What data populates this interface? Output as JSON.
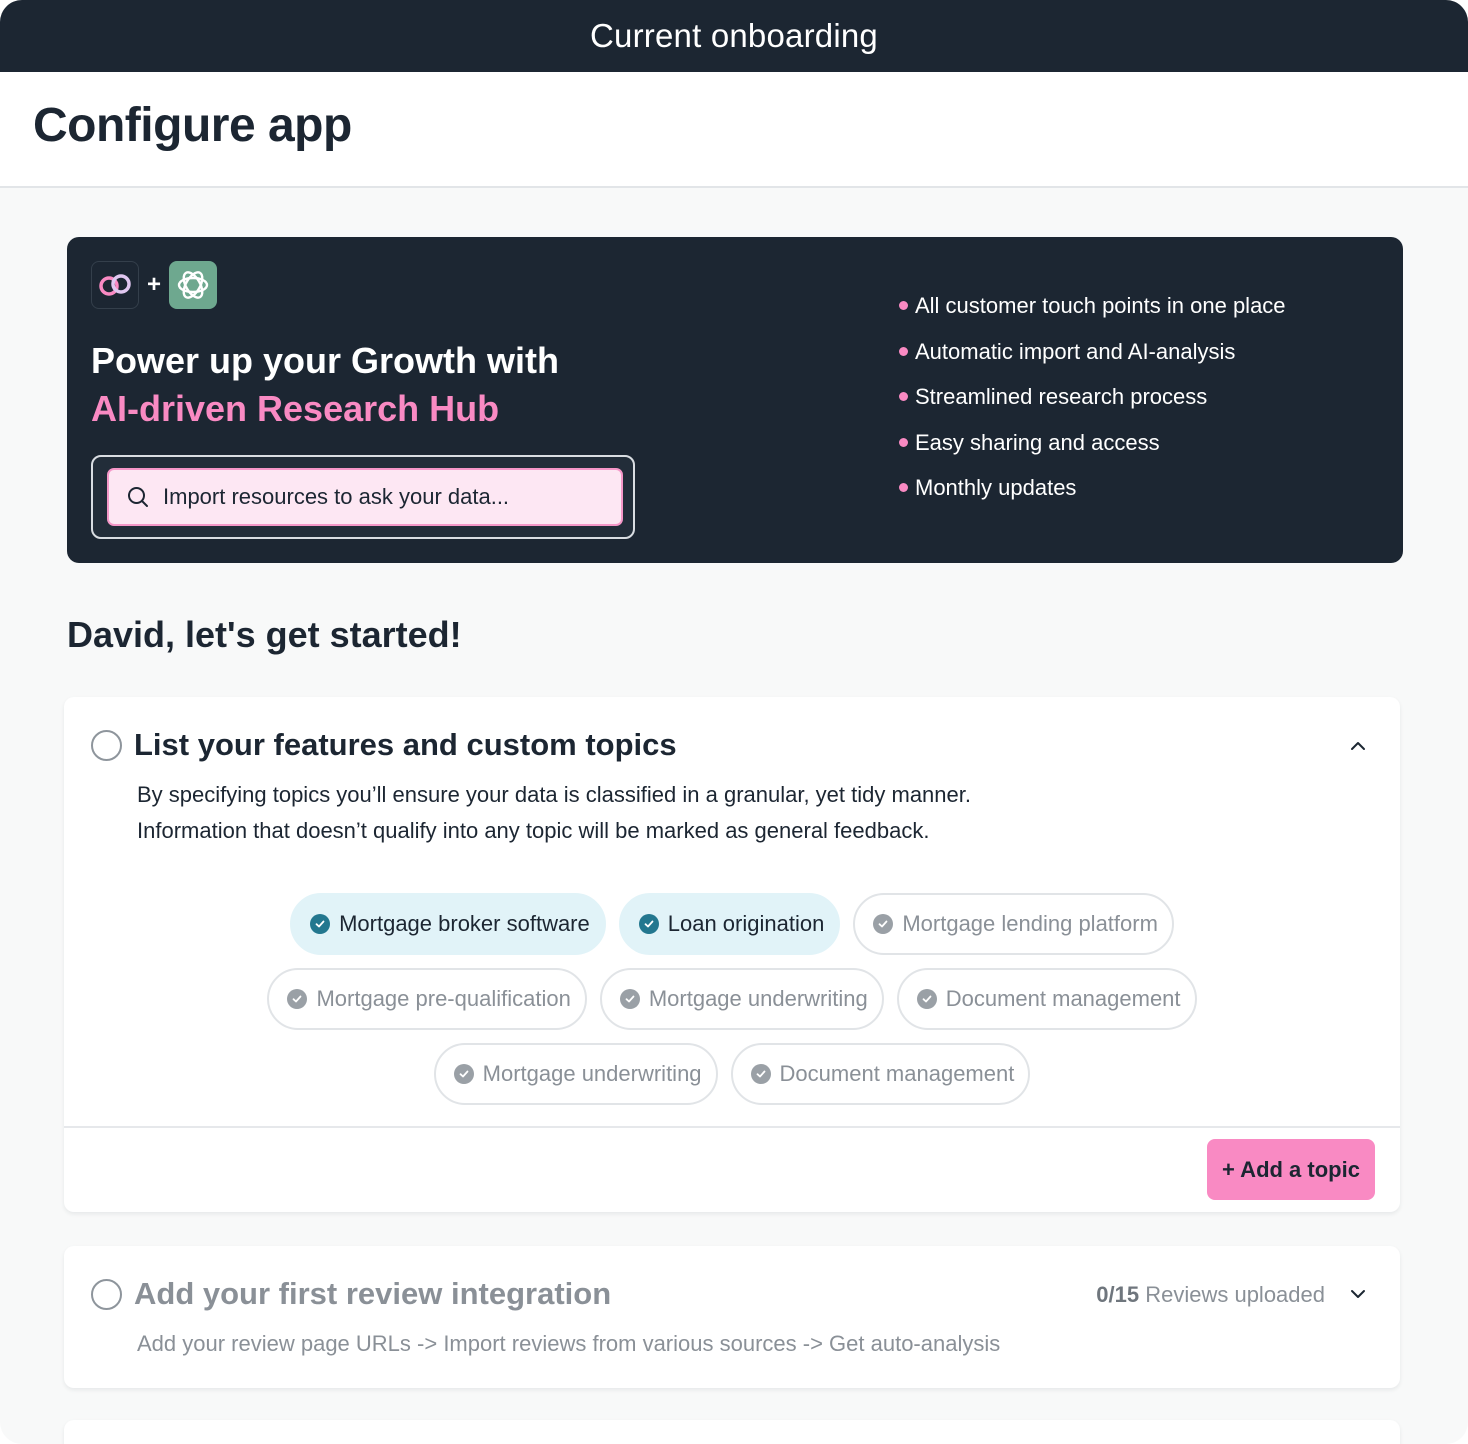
{
  "topbar": {
    "title": "Current onboarding"
  },
  "page": {
    "title": "Configure app"
  },
  "hero": {
    "title_line1": "Power up your Growth with",
    "title_line2": "AI-driven Research Hub",
    "search_placeholder": "Import resources to ask your data...",
    "bullets": [
      "All customer touch points in one place",
      "Automatic import and AI-analysis",
      "Streamlined research process",
      "Easy sharing and access",
      "Monthly updates"
    ],
    "colors": {
      "accent": "#f98ac3",
      "background": "#1c2632",
      "ai_logo": "#6ea88f"
    }
  },
  "greeting": "David, let's get started!",
  "steps": [
    {
      "title": "List your features and custom topics",
      "description_line1": "By specifying topics you’ll ensure your data is classified in a granular, yet tidy manner.",
      "description_line2": "Information that doesn’t qualify into any topic will be marked as general feedback.",
      "expanded": true,
      "topics": [
        {
          "label": "Mortgage broker software",
          "selected": true
        },
        {
          "label": "Loan origination",
          "selected": true
        },
        {
          "label": "Mortgage lending platform",
          "selected": false
        },
        {
          "label": "Mortgage pre-qualification",
          "selected": false
        },
        {
          "label": "Mortgage underwriting",
          "selected": false
        },
        {
          "label": "Document management",
          "selected": false
        },
        {
          "label": "Mortgage underwriting",
          "selected": false
        },
        {
          "label": "Document management",
          "selected": false
        }
      ],
      "add_button": "+ Add a topic"
    },
    {
      "title": "Add your first review integration",
      "progress_count": "0/15",
      "progress_label": "Reviews uploaded",
      "description": "Add your review page URLs -> Import reviews from various sources -> Get auto-analysis",
      "expanded": false
    }
  ],
  "icons": {
    "search": "search-icon",
    "check": "check-circle-icon",
    "chevron_up": "chevron-up-icon",
    "chevron_down": "chevron-down-icon"
  }
}
